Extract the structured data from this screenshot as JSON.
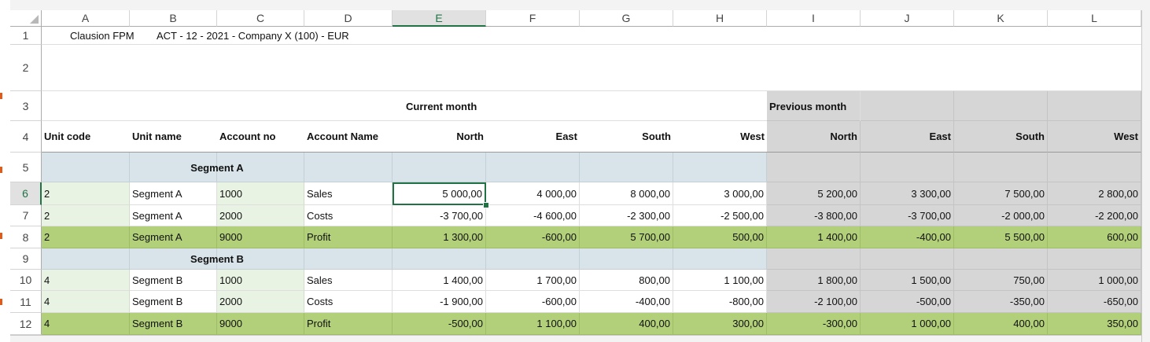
{
  "columns": [
    "A",
    "B",
    "C",
    "D",
    "E",
    "F",
    "G",
    "H",
    "I",
    "J",
    "K",
    "L"
  ],
  "selected_column": "E",
  "rows": [
    "1",
    "2",
    "3",
    "4",
    "5",
    "6",
    "7",
    "8",
    "9",
    "10",
    "11",
    "12"
  ],
  "selected_row": "6",
  "sheet": {
    "title_app": "Clausion FPM",
    "title_context": "ACT - 12 - 2021 - Company X (100) - EUR",
    "current_month_label": "Current month",
    "previous_month_label": "Previous month",
    "headers": [
      "Unit code",
      "Unit name",
      "Account no",
      "Account Name",
      "North",
      "East",
      "South",
      "West",
      "North",
      "East",
      "South",
      "West"
    ],
    "segment_a_label": "Segment A",
    "segment_b_label": "Segment B",
    "data_rows": [
      {
        "cells": [
          "2",
          "Segment A",
          "1000",
          "Sales",
          "5 000,00",
          "4 000,00",
          "8 000,00",
          "3 000,00",
          "5 200,00",
          "3 300,00",
          "7 500,00",
          "2 800,00"
        ]
      },
      {
        "cells": [
          "2",
          "Segment A",
          "2000",
          "Costs",
          "-3 700,00",
          "-4 600,00",
          "-2 300,00",
          "-2 500,00",
          "-3 800,00",
          "-3 700,00",
          "-2 000,00",
          "-2 200,00"
        ]
      },
      {
        "cells": [
          "2",
          "Segment A",
          "9000",
          "Profit",
          "1 300,00",
          "-600,00",
          "5 700,00",
          "500,00",
          "1 400,00",
          "-400,00",
          "5 500,00",
          "600,00"
        ]
      },
      {
        "cells": [
          "4",
          "Segment B",
          "1000",
          "Sales",
          "1 400,00",
          "1 700,00",
          "800,00",
          "1 100,00",
          "1 800,00",
          "1 500,00",
          "750,00",
          "1 000,00"
        ]
      },
      {
        "cells": [
          "4",
          "Segment B",
          "2000",
          "Costs",
          "-1 900,00",
          "-600,00",
          "-400,00",
          "-800,00",
          "-2 100,00",
          "-500,00",
          "-350,00",
          "-650,00"
        ]
      },
      {
        "cells": [
          "4",
          "Segment B",
          "9000",
          "Profit",
          "-500,00",
          "1 100,00",
          "400,00",
          "300,00",
          "-300,00",
          "1 000,00",
          "400,00",
          "350,00"
        ]
      }
    ]
  },
  "colors": {
    "accent": "#217346",
    "segment_band": "#d9e4ea",
    "key_cells": "#e9f3e3",
    "profit_row": "#b2cf7a",
    "previous_month": "#d6d6d6"
  }
}
